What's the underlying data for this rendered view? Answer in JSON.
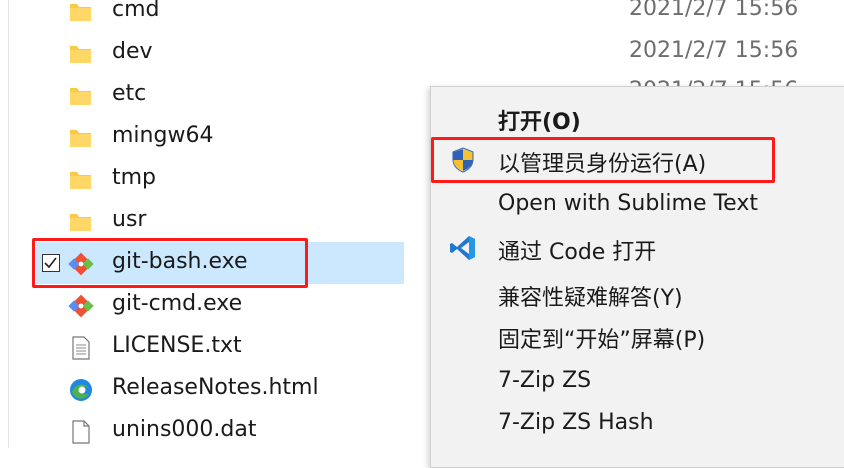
{
  "file_list": {
    "rows": [
      {
        "name": "cmd",
        "date": "2021/2/7 15:56",
        "icon": "folder-icon"
      },
      {
        "name": "dev",
        "date": "2021/2/7 15:56",
        "icon": "folder-icon"
      },
      {
        "name": "etc",
        "date": "2021/2/7 15:56",
        "icon": "folder-icon"
      },
      {
        "name": "mingw64",
        "date": "",
        "icon": "folder-icon"
      },
      {
        "name": "tmp",
        "date": "",
        "icon": "folder-icon"
      },
      {
        "name": "usr",
        "date": "",
        "icon": "folder-icon"
      },
      {
        "name": "git-bash.exe",
        "date": "",
        "icon": "git-icon",
        "selected": true,
        "checked": true
      },
      {
        "name": "git-cmd.exe",
        "date": "",
        "icon": "git-icon"
      },
      {
        "name": "LICENSE.txt",
        "date": "",
        "icon": "text-file-icon"
      },
      {
        "name": "ReleaseNotes.html",
        "date": "",
        "icon": "edge-icon"
      },
      {
        "name": "unins000.dat",
        "date": "",
        "icon": "blank-file-icon"
      }
    ]
  },
  "context_menu": {
    "items": [
      {
        "label": "打开(O)",
        "bold": true,
        "icon": ""
      },
      {
        "label": "以管理员身份运行(A)",
        "bold": false,
        "icon": "uac-shield-icon"
      },
      {
        "label": "Open with Sublime Text",
        "bold": false,
        "icon": ""
      },
      {
        "label": "通过 Code 打开",
        "bold": false,
        "icon": "vscode-icon"
      },
      {
        "label": "兼容性疑难解答(Y)",
        "bold": false,
        "icon": ""
      },
      {
        "label": "固定到“开始”屏幕(P)",
        "bold": false,
        "icon": ""
      },
      {
        "label": "7-Zip ZS",
        "bold": false,
        "icon": ""
      },
      {
        "label": "7-Zip ZS Hash",
        "bold": false,
        "icon": ""
      }
    ]
  },
  "colors": {
    "highlight": "#ff1a1a",
    "selection": "#cce8ff",
    "folder": "#f8c94a",
    "menu_bg": "#f2f2f2"
  }
}
